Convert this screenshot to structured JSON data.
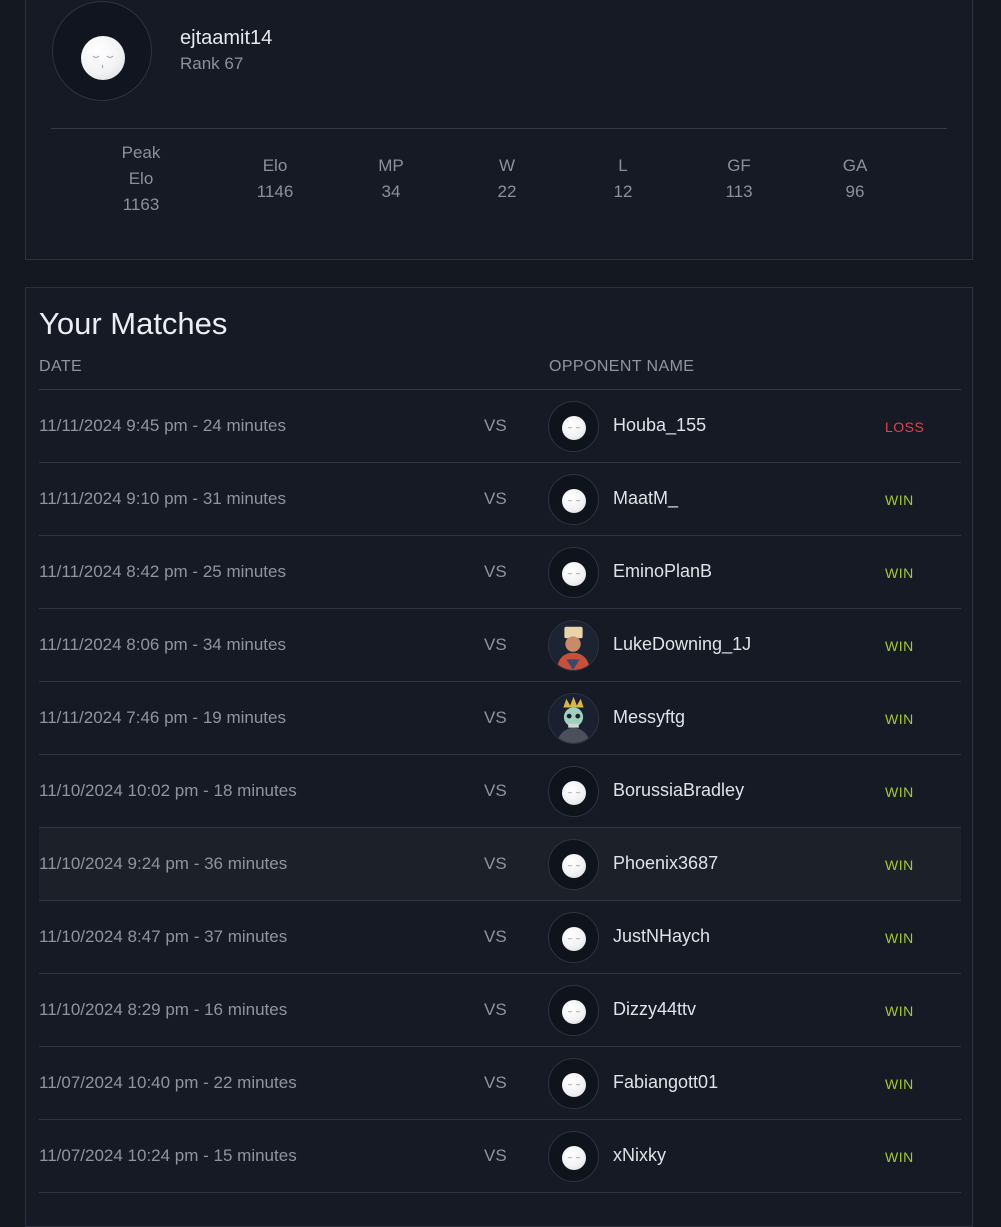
{
  "profile": {
    "username": "ejtaamit14",
    "rank": "Rank 67",
    "stats": [
      {
        "label": "Peak\nElo",
        "value": "1163"
      },
      {
        "label": "Elo",
        "value": "1146"
      },
      {
        "label": "MP",
        "value": "34"
      },
      {
        "label": "W",
        "value": "22"
      },
      {
        "label": "L",
        "value": "12"
      },
      {
        "label": "GF",
        "value": "113"
      },
      {
        "label": "GA",
        "value": "96"
      }
    ]
  },
  "matches": {
    "title": "Your Matches",
    "columns": {
      "date": "DATE",
      "opponent": "OPPONENT NAME"
    },
    "rows": [
      {
        "date": "11/11/2024 9:45 pm - 24 minutes",
        "vs": "VS",
        "opponent": "Houba_155",
        "avatar": "default-face-icon",
        "result": "LOSS"
      },
      {
        "date": "11/11/2024 9:10 pm - 31 minutes",
        "vs": "VS",
        "opponent": "MaatM_",
        "avatar": "default-face-icon",
        "result": "WIN"
      },
      {
        "date": "11/11/2024 8:42 pm - 25 minutes",
        "vs": "VS",
        "opponent": "EminoPlanB",
        "avatar": "default-face-icon",
        "result": "WIN"
      },
      {
        "date": "11/11/2024 8:06 pm - 34 minutes",
        "vs": "VS",
        "opponent": "LukeDowning_1J",
        "avatar": "character-avatar",
        "result": "WIN"
      },
      {
        "date": "11/11/2024 7:46 pm - 19 minutes",
        "vs": "VS",
        "opponent": "Messyftg",
        "avatar": "skull-king-avatar",
        "result": "WIN"
      },
      {
        "date": "11/10/2024 10:02 pm - 18 minutes",
        "vs": "VS",
        "opponent": "BorussiaBradley",
        "avatar": "default-face-icon",
        "result": "WIN"
      },
      {
        "date": "11/10/2024 9:24 pm - 36 minutes",
        "vs": "VS",
        "opponent": "Phoenix3687",
        "avatar": "default-face-icon",
        "result": "WIN"
      },
      {
        "date": "11/10/2024 8:47 pm - 37 minutes",
        "vs": "VS",
        "opponent": "JustNHaych",
        "avatar": "default-face-icon",
        "result": "WIN"
      },
      {
        "date": "11/10/2024 8:29 pm - 16 minutes",
        "vs": "VS",
        "opponent": "Dizzy44ttv",
        "avatar": "default-face-icon",
        "result": "WIN"
      },
      {
        "date": "11/07/2024 10:40 pm - 22 minutes",
        "vs": "VS",
        "opponent": "Fabiangott01",
        "avatar": "default-face-icon",
        "result": "WIN"
      },
      {
        "date": "11/07/2024 10:24 pm - 15 minutes",
        "vs": "VS",
        "opponent": "xNixky",
        "avatar": "default-face-icon",
        "result": "WIN"
      }
    ]
  },
  "colors": {
    "win": "#a3c83a",
    "loss": "#e0434c",
    "background": "#141821"
  }
}
